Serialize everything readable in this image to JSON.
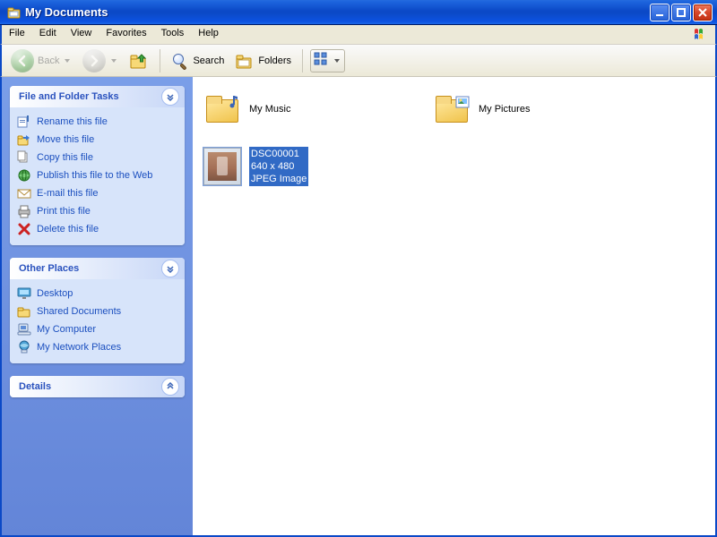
{
  "titlebar": {
    "title": "My Documents"
  },
  "menu": {
    "file": "File",
    "edit": "Edit",
    "view": "View",
    "favorites": "Favorites",
    "tools": "Tools",
    "help": "Help"
  },
  "toolbar": {
    "back": "Back",
    "search": "Search",
    "folders": "Folders"
  },
  "sidebar": {
    "file_tasks": {
      "title": "File and Folder Tasks",
      "items": [
        {
          "id": "rename",
          "label": "Rename this file"
        },
        {
          "id": "move",
          "label": "Move this file"
        },
        {
          "id": "copy",
          "label": "Copy this file"
        },
        {
          "id": "publish",
          "label": "Publish this file to the Web"
        },
        {
          "id": "email",
          "label": "E-mail this file"
        },
        {
          "id": "print",
          "label": "Print this file"
        },
        {
          "id": "delete",
          "label": "Delete this file"
        }
      ]
    },
    "other_places": {
      "title": "Other Places",
      "items": [
        {
          "id": "desktop",
          "label": "Desktop"
        },
        {
          "id": "shared-docs",
          "label": "Shared Documents"
        },
        {
          "id": "my-computer",
          "label": "My Computer"
        },
        {
          "id": "my-network",
          "label": "My Network Places"
        }
      ]
    },
    "details": {
      "title": "Details"
    }
  },
  "content": {
    "items": [
      {
        "id": "my-music",
        "kind": "special-folder",
        "badge": "music",
        "line1": "My Music",
        "selected": false
      },
      {
        "id": "my-pictures",
        "kind": "special-folder",
        "badge": "pictures",
        "line1": "My Pictures",
        "selected": false
      },
      {
        "id": "dsc00001",
        "kind": "image-file",
        "line1": "DSC00001",
        "line2": "640 x 480",
        "line3": "JPEG Image",
        "selected": true
      }
    ]
  }
}
